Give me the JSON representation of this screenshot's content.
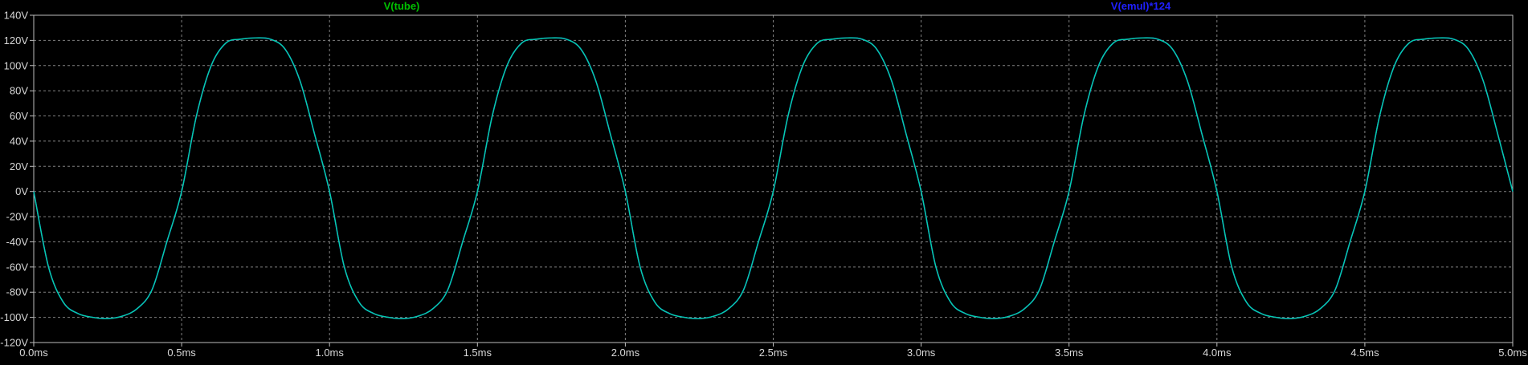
{
  "chart_data": {
    "type": "line",
    "title": "",
    "xlabel": "",
    "ylabel": "",
    "xlim": [
      0,
      5
    ],
    "ylim": [
      -120,
      140
    ],
    "x_unit": "ms",
    "y_unit": "V",
    "grid": true,
    "legend_placement": "top",
    "background": "#000000",
    "grid_color": "#808080",
    "x_ticks": [
      "0.0ms",
      "0.5ms",
      "1.0ms",
      "1.5ms",
      "2.0ms",
      "2.5ms",
      "3.0ms",
      "3.5ms",
      "4.0ms",
      "4.5ms",
      "5.0ms"
    ],
    "x_tick_values": [
      0,
      0.5,
      1.0,
      1.5,
      2.0,
      2.5,
      3.0,
      3.5,
      4.0,
      4.5,
      5.0
    ],
    "y_ticks": [
      "140V",
      "120V",
      "100V",
      "80V",
      "60V",
      "40V",
      "20V",
      "0V",
      "-20V",
      "-40V",
      "-60V",
      "-80V",
      "-100V",
      "-120V"
    ],
    "y_tick_values": [
      140,
      120,
      100,
      80,
      60,
      40,
      20,
      0,
      -20,
      -40,
      -60,
      -80,
      -100,
      -120
    ],
    "series": [
      {
        "name": "V(tube)",
        "color": "#00c000",
        "line_color": "#00d8a0",
        "x": [
          0,
          0.05,
          0.1,
          0.15,
          0.2,
          0.25,
          0.3,
          0.35,
          0.4,
          0.45,
          0.5,
          0.55,
          0.6,
          0.65,
          0.7,
          0.75,
          0.8,
          0.85,
          0.9,
          0.95,
          1.0,
          1.05,
          1.1,
          1.15,
          1.2,
          1.25,
          1.3,
          1.35,
          1.4,
          1.45,
          1.5,
          1.55,
          1.6,
          1.65,
          1.7,
          1.75,
          1.8,
          1.85,
          1.9,
          1.95,
          2.0,
          2.05,
          2.1,
          2.15,
          2.2,
          2.25,
          2.3,
          2.35,
          2.4,
          2.45,
          2.5,
          2.55,
          2.6,
          2.65,
          2.7,
          2.75,
          2.8,
          2.85,
          2.9,
          2.95,
          3.0,
          3.05,
          3.1,
          3.15,
          3.2,
          3.25,
          3.3,
          3.35,
          3.4,
          3.45,
          3.5,
          3.55,
          3.6,
          3.65,
          3.7,
          3.75,
          3.8,
          3.85,
          3.9,
          3.95,
          4.0,
          4.05,
          4.1,
          4.15,
          4.2,
          4.25,
          4.3,
          4.35,
          4.4,
          4.45,
          4.5,
          4.55,
          4.6,
          4.65,
          4.7,
          4.75,
          4.8,
          4.85,
          4.9,
          4.95,
          5.0
        ],
        "y": [
          0,
          -60,
          -88,
          -97,
          -100,
          -101,
          -99,
          -93,
          -78,
          -40,
          0,
          60,
          100,
          118,
          121,
          122,
          121,
          113,
          88,
          45,
          0,
          -60,
          -88,
          -97,
          -100,
          -101,
          -99,
          -93,
          -78,
          -40,
          0,
          60,
          100,
          118,
          121,
          122,
          121,
          113,
          88,
          45,
          0,
          -60,
          -88,
          -97,
          -100,
          -101,
          -99,
          -93,
          -78,
          -40,
          0,
          60,
          100,
          118,
          121,
          122,
          121,
          113,
          88,
          45,
          0,
          -60,
          -88,
          -97,
          -100,
          -101,
          -99,
          -93,
          -78,
          -40,
          0,
          60,
          100,
          118,
          121,
          122,
          121,
          113,
          88,
          45,
          0,
          -60,
          -88,
          -97,
          -100,
          -101,
          -99,
          -93,
          -78,
          -40,
          0,
          60,
          100,
          118,
          121,
          122,
          121,
          113,
          88,
          45,
          0
        ]
      },
      {
        "name": "V(emul)*124",
        "color": "#2020ff",
        "line_color": "#2a4dff",
        "x": [
          0,
          0.05,
          0.1,
          0.15,
          0.2,
          0.25,
          0.3,
          0.35,
          0.4,
          0.45,
          0.5,
          0.55,
          0.6,
          0.65,
          0.7,
          0.75,
          0.8,
          0.85,
          0.9,
          0.95,
          1.0,
          1.05,
          1.1,
          1.15,
          1.2,
          1.25,
          1.3,
          1.35,
          1.4,
          1.45,
          1.5,
          1.55,
          1.6,
          1.65,
          1.7,
          1.75,
          1.8,
          1.85,
          1.9,
          1.95,
          2.0,
          2.05,
          2.1,
          2.15,
          2.2,
          2.25,
          2.3,
          2.35,
          2.4,
          2.45,
          2.5,
          2.55,
          2.6,
          2.65,
          2.7,
          2.75,
          2.8,
          2.85,
          2.9,
          2.95,
          3.0,
          3.05,
          3.1,
          3.15,
          3.2,
          3.25,
          3.3,
          3.35,
          3.4,
          3.45,
          3.5,
          3.55,
          3.6,
          3.65,
          3.7,
          3.75,
          3.8,
          3.85,
          3.9,
          3.95,
          4.0,
          4.05,
          4.1,
          4.15,
          4.2,
          4.25,
          4.3,
          4.35,
          4.4,
          4.45,
          4.5,
          4.55,
          4.6,
          4.65,
          4.7,
          4.75,
          4.8,
          4.85,
          4.9,
          4.95,
          5.0
        ],
        "y": [
          0,
          -60,
          -88,
          -97,
          -100,
          -101,
          -99,
          -93,
          -78,
          -40,
          0,
          60,
          100,
          118,
          121,
          122,
          121,
          113,
          88,
          45,
          0,
          -60,
          -88,
          -97,
          -100,
          -101,
          -99,
          -93,
          -78,
          -40,
          0,
          60,
          100,
          118,
          121,
          122,
          121,
          113,
          88,
          45,
          0,
          -60,
          -88,
          -97,
          -100,
          -101,
          -99,
          -93,
          -78,
          -40,
          0,
          60,
          100,
          118,
          121,
          122,
          121,
          113,
          88,
          45,
          0,
          -60,
          -88,
          -97,
          -100,
          -101,
          -99,
          -93,
          -78,
          -40,
          0,
          60,
          100,
          118,
          121,
          122,
          121,
          113,
          88,
          45,
          0,
          -60,
          -88,
          -97,
          -100,
          -101,
          -99,
          -93,
          -78,
          -40,
          0,
          60,
          100,
          118,
          121,
          122,
          121,
          113,
          88,
          45,
          0
        ]
      }
    ]
  }
}
